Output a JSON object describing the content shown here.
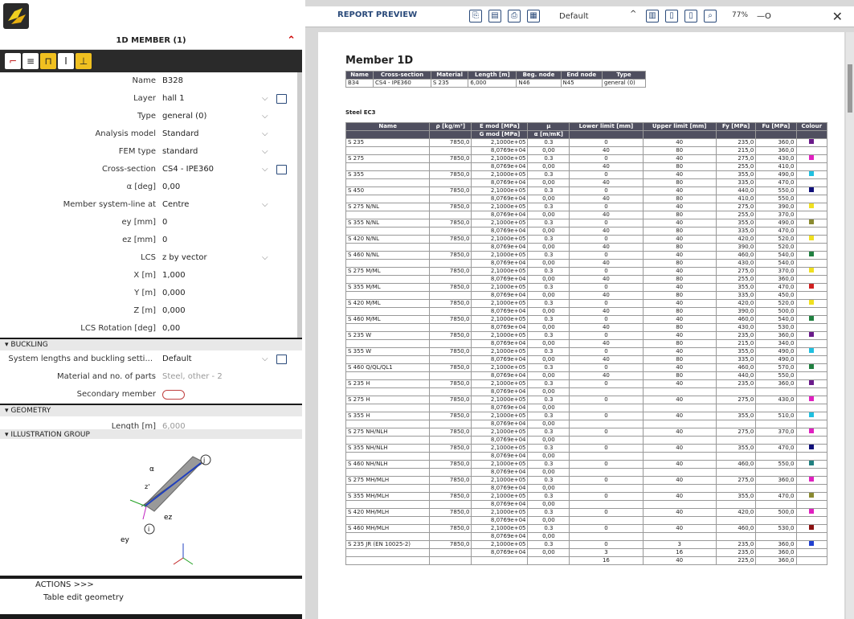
{
  "panel": {
    "title": "1D MEMBER (1)"
  },
  "props": [
    {
      "label": "Name",
      "value": "B328",
      "dd": false,
      "ico": false
    },
    {
      "label": "Layer",
      "value": "hall 1",
      "dd": true,
      "ico": true
    },
    {
      "label": "Type",
      "value": "general (0)",
      "dd": true,
      "ico": false
    },
    {
      "label": "Analysis model",
      "value": "Standard",
      "dd": true,
      "ico": false
    },
    {
      "label": "FEM type",
      "value": "standard",
      "dd": true,
      "ico": false
    },
    {
      "label": "Cross-section",
      "value": "CS4 - IPE360",
      "dd": true,
      "ico": true
    },
    {
      "label": "α [deg]",
      "value": "0,00",
      "dd": false,
      "ico": false
    },
    {
      "label": "Member system-line at",
      "value": "Centre",
      "dd": true,
      "ico": false
    },
    {
      "label": "ey [mm]",
      "value": "0",
      "dd": false,
      "ico": false
    },
    {
      "label": "ez [mm]",
      "value": "0",
      "dd": false,
      "ico": false
    },
    {
      "label": "LCS",
      "value": "z by vector",
      "dd": true,
      "ico": false
    },
    {
      "label": "X [m]",
      "value": "1,000",
      "dd": false,
      "ico": false
    },
    {
      "label": "Y [m]",
      "value": "0,000",
      "dd": false,
      "ico": false
    },
    {
      "label": "Z [m]",
      "value": "0,000",
      "dd": false,
      "ico": false
    },
    {
      "label": "LCS Rotation [deg]",
      "value": "0,00",
      "dd": false,
      "ico": false
    }
  ],
  "buckling": {
    "header": "BUCKLING",
    "sys_label": "System lengths and buckling setti...",
    "sys_value": "Default",
    "mat_label": "Material and no. of parts",
    "mat_value": "Steel, other - 2",
    "sec_label": "Secondary member"
  },
  "geometry": {
    "header": "GEOMETRY",
    "length_label": "Length [m]",
    "length_value": "6,000"
  },
  "illustration": {
    "header": "ILLUSTRATION GROUP",
    "labels": {
      "alpha": "α",
      "z": "z'",
      "j": "j",
      "i": "i",
      "ez": "ez",
      "ey": "ey"
    }
  },
  "actions": {
    "header": "ACTIONS",
    "chev": ">>>",
    "item": "Table edit geometry"
  },
  "report": {
    "title": "REPORT PREVIEW",
    "template": "Default",
    "zoom": "77%",
    "close": "✕"
  },
  "member": {
    "title": "Member 1D",
    "headers": [
      "Name",
      "Cross-section",
      "Material",
      "Length [m]",
      "Beg. node",
      "End node",
      "Type"
    ],
    "row": [
      "B34",
      "CS4 - IPE360",
      "S 235",
      "6,000",
      "N46",
      "N45",
      "general (0)"
    ]
  },
  "steel_label": "Steel EC3",
  "mat_headers": [
    "Name",
    "ρ [kg/m³]",
    "E mod [MPa]",
    "μ",
    "Lower limit [mm]",
    "Upper limit [mm]",
    "Fy [MPa]",
    "Fu [MPa]",
    "Colour"
  ],
  "mat_sub": [
    "",
    "",
    "G mod [MPa]",
    "α [m/mK]",
    "",
    "",
    "",
    "",
    ""
  ],
  "materials": [
    {
      "n": "S 235",
      "c": "#6a1a8a",
      "r": [
        [
          "7850,0",
          "2,1000e+05",
          "0.3",
          "0",
          "40",
          "235,0",
          "360,0"
        ],
        [
          "",
          "8,0769e+04",
          "0,00",
          "40",
          "80",
          "215,0",
          "360,0"
        ]
      ]
    },
    {
      "n": "S 275",
      "c": "#e020c0",
      "r": [
        [
          "7850,0",
          "2,1000e+05",
          "0.3",
          "0",
          "40",
          "275,0",
          "430,0"
        ],
        [
          "",
          "8,0769e+04",
          "0,00",
          "40",
          "80",
          "255,0",
          "410,0"
        ]
      ]
    },
    {
      "n": "S 355",
      "c": "#20c0e0",
      "r": [
        [
          "7850,0",
          "2,1000e+05",
          "0.3",
          "0",
          "40",
          "355,0",
          "490,0"
        ],
        [
          "",
          "8,0769e+04",
          "0,00",
          "40",
          "80",
          "335,0",
          "470,0"
        ]
      ]
    },
    {
      "n": "S 450",
      "c": "#10107a",
      "r": [
        [
          "7850,0",
          "2,1000e+05",
          "0.3",
          "0",
          "40",
          "440,0",
          "550,0"
        ],
        [
          "",
          "8,0769e+04",
          "0,00",
          "40",
          "80",
          "410,0",
          "550,0"
        ]
      ]
    },
    {
      "n": "S 275 N/NL",
      "c": "#f0e020",
      "r": [
        [
          "7850,0",
          "2,1000e+05",
          "0.3",
          "0",
          "40",
          "275,0",
          "390,0"
        ],
        [
          "",
          "8,0769e+04",
          "0,00",
          "40",
          "80",
          "255,0",
          "370,0"
        ]
      ]
    },
    {
      "n": "S 355 N/NL",
      "c": "#8a8a30",
      "r": [
        [
          "7850,0",
          "2,1000e+05",
          "0.3",
          "0",
          "40",
          "355,0",
          "490,0"
        ],
        [
          "",
          "8,0769e+04",
          "0,00",
          "40",
          "80",
          "335,0",
          "470,0"
        ]
      ]
    },
    {
      "n": "S 420 N/NL",
      "c": "#f0e020",
      "r": [
        [
          "7850,0",
          "2,1000e+05",
          "0.3",
          "0",
          "40",
          "420,0",
          "520,0"
        ],
        [
          "",
          "8,0769e+04",
          "0,00",
          "40",
          "80",
          "390,0",
          "520,0"
        ]
      ]
    },
    {
      "n": "S 460 N/NL",
      "c": "#208040",
      "r": [
        [
          "7850,0",
          "2,1000e+05",
          "0.3",
          "0",
          "40",
          "460,0",
          "540,0"
        ],
        [
          "",
          "8,0769e+04",
          "0,00",
          "40",
          "80",
          "430,0",
          "540,0"
        ]
      ]
    },
    {
      "n": "S 275 M/ML",
      "c": "#f0e020",
      "r": [
        [
          "7850,0",
          "2,1000e+05",
          "0.3",
          "0",
          "40",
          "275,0",
          "370,0"
        ],
        [
          "",
          "8,0769e+04",
          "0,00",
          "40",
          "80",
          "255,0",
          "360,0"
        ]
      ]
    },
    {
      "n": "S 355 M/ML",
      "c": "#d02020",
      "r": [
        [
          "7850,0",
          "2,1000e+05",
          "0.3",
          "0",
          "40",
          "355,0",
          "470,0"
        ],
        [
          "",
          "8,0769e+04",
          "0,00",
          "40",
          "80",
          "335,0",
          "450,0"
        ]
      ]
    },
    {
      "n": "S 420 M/ML",
      "c": "#f0e020",
      "r": [
        [
          "7850,0",
          "2,1000e+05",
          "0.3",
          "0",
          "40",
          "420,0",
          "520,0"
        ],
        [
          "",
          "8,0769e+04",
          "0,00",
          "40",
          "80",
          "390,0",
          "500,0"
        ]
      ]
    },
    {
      "n": "S 460 M/ML",
      "c": "#208040",
      "r": [
        [
          "7850,0",
          "2,1000e+05",
          "0.3",
          "0",
          "40",
          "460,0",
          "540,0"
        ],
        [
          "",
          "8,0769e+04",
          "0,00",
          "40",
          "80",
          "430,0",
          "530,0"
        ]
      ]
    },
    {
      "n": "S 235 W",
      "c": "#6a1a8a",
      "r": [
        [
          "7850,0",
          "2,1000e+05",
          "0.3",
          "0",
          "40",
          "235,0",
          "360,0"
        ],
        [
          "",
          "8,0769e+04",
          "0,00",
          "40",
          "80",
          "215,0",
          "340,0"
        ]
      ]
    },
    {
      "n": "S 355 W",
      "c": "#20c0e0",
      "r": [
        [
          "7850,0",
          "2,1000e+05",
          "0.3",
          "0",
          "40",
          "355,0",
          "490,0"
        ],
        [
          "",
          "8,0769e+04",
          "0,00",
          "40",
          "80",
          "335,0",
          "490,0"
        ]
      ]
    },
    {
      "n": "S 460 Q/QL/QL1",
      "c": "#208040",
      "r": [
        [
          "7850,0",
          "2,1000e+05",
          "0.3",
          "0",
          "40",
          "460,0",
          "570,0"
        ],
        [
          "",
          "8,0769e+04",
          "0,00",
          "40",
          "80",
          "440,0",
          "550,0"
        ]
      ]
    },
    {
      "n": "S 235 H",
      "c": "#6a1a8a",
      "r": [
        [
          "7850,0",
          "2,1000e+05",
          "0.3",
          "0",
          "40",
          "235,0",
          "360,0"
        ],
        [
          "",
          "8,0769e+04",
          "0,00",
          "",
          "",
          "",
          ""
        ]
      ]
    },
    {
      "n": "S 275 H",
      "c": "#e020c0",
      "r": [
        [
          "7850,0",
          "2,1000e+05",
          "0.3",
          "0",
          "40",
          "275,0",
          "430,0"
        ],
        [
          "",
          "8,0769e+04",
          "0,00",
          "",
          "",
          "",
          ""
        ]
      ]
    },
    {
      "n": "S 355 H",
      "c": "#20c0e0",
      "r": [
        [
          "7850,0",
          "2,1000e+05",
          "0.3",
          "0",
          "40",
          "355,0",
          "510,0"
        ],
        [
          "",
          "8,0769e+04",
          "0,00",
          "",
          "",
          "",
          ""
        ]
      ]
    },
    {
      "n": "S 275 NH/NLH",
      "c": "#e020c0",
      "r": [
        [
          "7850,0",
          "2,1000e+05",
          "0.3",
          "0",
          "40",
          "275,0",
          "370,0"
        ],
        [
          "",
          "8,0769e+04",
          "0,00",
          "",
          "",
          "",
          ""
        ]
      ]
    },
    {
      "n": "S 355 NH/NLH",
      "c": "#10107a",
      "r": [
        [
          "7850,0",
          "2,1000e+05",
          "0.3",
          "0",
          "40",
          "355,0",
          "470,0"
        ],
        [
          "",
          "8,0769e+04",
          "0,00",
          "",
          "",
          "",
          ""
        ]
      ]
    },
    {
      "n": "S 460 NH/NLH",
      "c": "#208080",
      "r": [
        [
          "7850,0",
          "2,1000e+05",
          "0.3",
          "0",
          "40",
          "460,0",
          "550,0"
        ],
        [
          "",
          "8,0769e+04",
          "0,00",
          "",
          "",
          "",
          ""
        ]
      ]
    },
    {
      "n": "S 275 MH/MLH",
      "c": "#e020c0",
      "r": [
        [
          "7850,0",
          "2,1000e+05",
          "0.3",
          "0",
          "40",
          "275,0",
          "360,0"
        ],
        [
          "",
          "8,0769e+04",
          "0,00",
          "",
          "",
          "",
          ""
        ]
      ]
    },
    {
      "n": "S 355 MH/MLH",
      "c": "#8a8a30",
      "r": [
        [
          "7850,0",
          "2,1000e+05",
          "0.3",
          "0",
          "40",
          "355,0",
          "470,0"
        ],
        [
          "",
          "8,0769e+04",
          "0,00",
          "",
          "",
          "",
          ""
        ]
      ]
    },
    {
      "n": "S 420 MH/MLH",
      "c": "#e020c0",
      "r": [
        [
          "7850,0",
          "2,1000e+05",
          "0.3",
          "0",
          "40",
          "420,0",
          "500,0"
        ],
        [
          "",
          "8,0769e+04",
          "0,00",
          "",
          "",
          "",
          ""
        ]
      ]
    },
    {
      "n": "S 460 MH/MLH",
      "c": "#8a1010",
      "r": [
        [
          "7850,0",
          "2,1000e+05",
          "0.3",
          "0",
          "40",
          "460,0",
          "530,0"
        ],
        [
          "",
          "8,0769e+04",
          "0,00",
          "",
          "",
          "",
          ""
        ]
      ]
    },
    {
      "n": "S 235 JR (EN 10025-2)",
      "c": "#2040d0",
      "r": [
        [
          "7850,0",
          "2,1000e+05",
          "0.3",
          "0",
          "3",
          "235,0",
          "360,0"
        ],
        [
          "",
          "8,0769e+04",
          "0,00",
          "3",
          "16",
          "235,0",
          "360,0"
        ],
        [
          "",
          "",
          "",
          "16",
          "40",
          "225,0",
          "360,0"
        ]
      ]
    }
  ]
}
